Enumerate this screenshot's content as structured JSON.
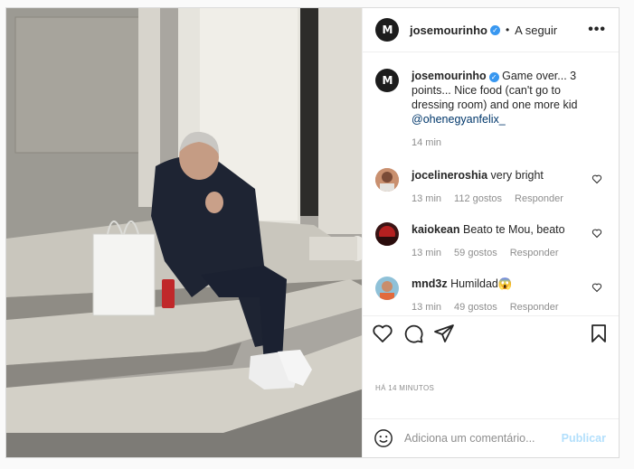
{
  "post": {
    "username": "josemourinho",
    "follow_label": "A seguir",
    "dot": "•",
    "more": "•••",
    "avatar_text": "M",
    "caption": {
      "username": "josemourinho",
      "text_1": " Game over... 3 points... Nice food (can't go to dressing room) and one more kid ",
      "mention": "@ohenegyanfelix_",
      "time": "14 min"
    },
    "comments": [
      {
        "username": "jocelineroshia",
        "text": "very bright",
        "time": "13 min",
        "likes": "112 gostos",
        "reply": "Responder"
      },
      {
        "username": "kaiokean",
        "text": "Beato te Mou, beato",
        "time": "13 min",
        "likes": "59 gostos",
        "reply": "Responder"
      },
      {
        "username": "mnd3z",
        "text": "Humildad😱",
        "time": "13 min",
        "likes": "49 gostos",
        "reply": "Responder"
      }
    ],
    "time_ago": "HÁ 14 MINUTOS",
    "comment_placeholder": "Adiciona um comentário...",
    "publish_label": "Publicar"
  },
  "colors": {
    "verified": "#3897f0",
    "link": "#00376b",
    "publish": "#b2dffc"
  },
  "icons": [
    "heart-icon",
    "comment-icon",
    "share-icon",
    "bookmark-icon",
    "emoji-icon",
    "more-options-icon",
    "verified-badge-icon"
  ]
}
